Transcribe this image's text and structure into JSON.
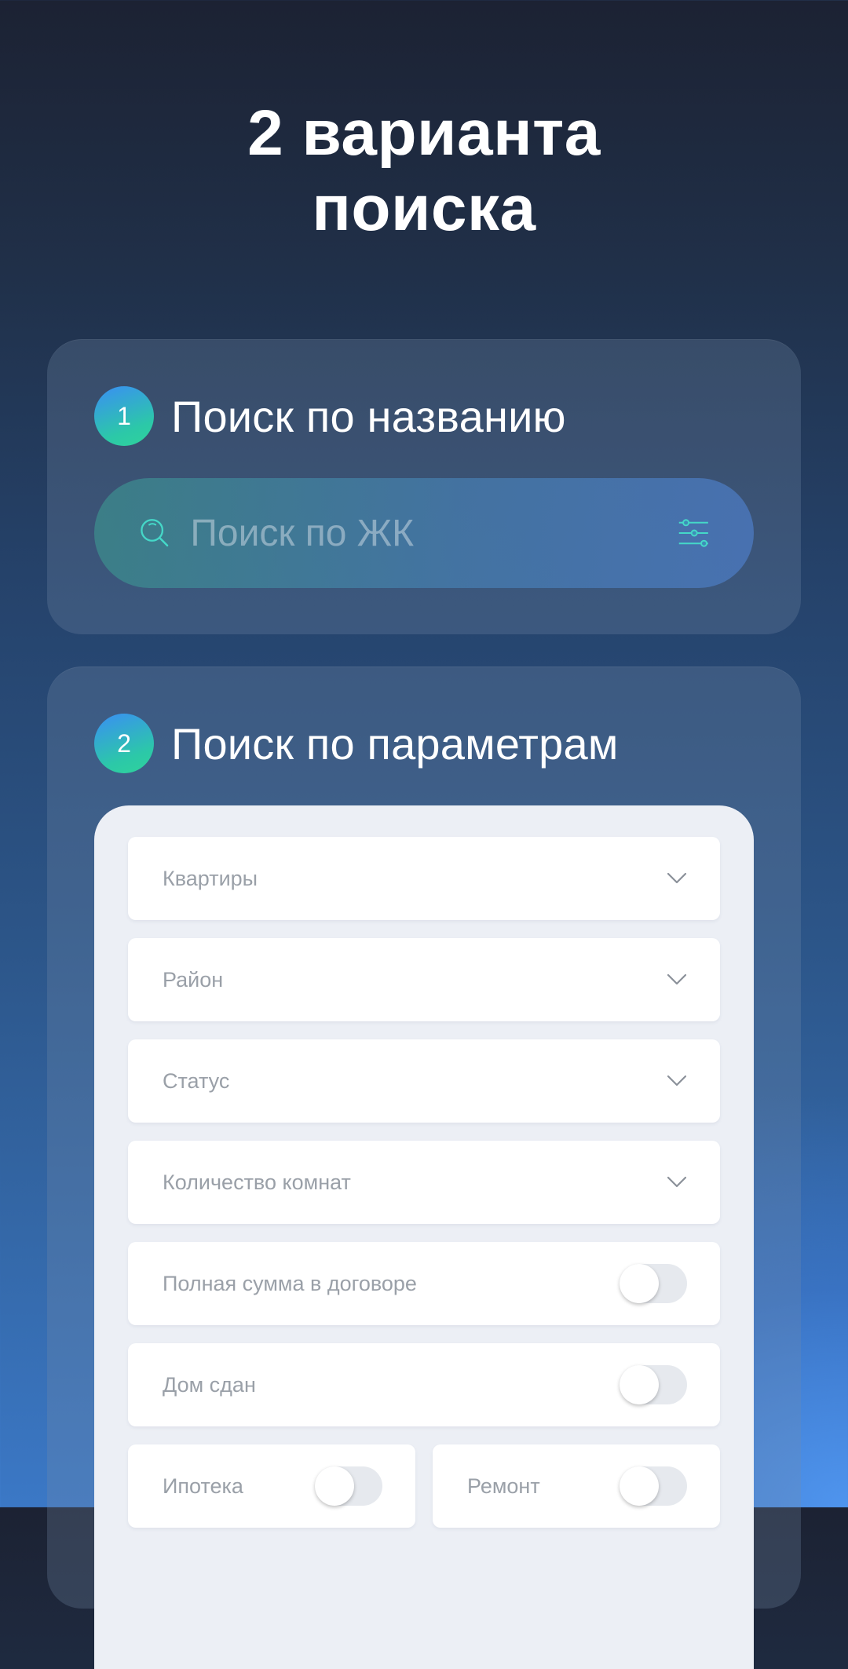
{
  "header": {
    "title_line1": "2 варианта",
    "title_line2": "поиска"
  },
  "section_name_search": {
    "badge": "1",
    "title": "Поиск по названию",
    "search": {
      "placeholder": "Поиск по ЖК",
      "icon": "search-icon",
      "filter_icon": "filter-sliders-icon"
    }
  },
  "section_param_search": {
    "badge": "2",
    "title": "Поиск по параметрам",
    "dropdowns": [
      {
        "label": "Квартиры",
        "icon": "chevron-down-icon"
      },
      {
        "label": "Район",
        "icon": "chevron-down-icon"
      },
      {
        "label": "Статус",
        "icon": "chevron-down-icon"
      },
      {
        "label": "Количество комнат",
        "icon": "chevron-down-icon"
      }
    ],
    "toggles": [
      {
        "label": "Полная сумма в договоре",
        "on": false
      },
      {
        "label": "Дом сдан",
        "on": false
      },
      {
        "label": "Ипотека",
        "on": false
      },
      {
        "label": "Ремонт",
        "on": false
      }
    ]
  },
  "colors": {
    "accent_gradient_start": "#3a8ef5",
    "accent_gradient_end": "#2fd39b",
    "search_icon": "#45d8c8",
    "panel_bg": "#eceff5",
    "field_text": "#9aa0a8"
  }
}
